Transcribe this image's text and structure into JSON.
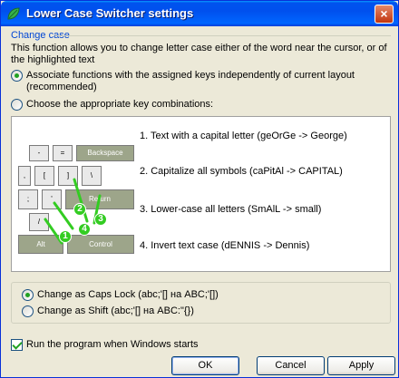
{
  "window": {
    "title": "Lower Case Switcher settings",
    "close_glyph": "×"
  },
  "group": {
    "label": "Change case"
  },
  "description": "This function allows you to change letter case either of the word near the cursor, or of the highlighted text",
  "radios_mode": [
    {
      "label": "Associate functions with the assigned keys independently of current layout (recommended)",
      "checked": true
    },
    {
      "label": "Choose the appropriate key combinations:",
      "checked": false
    }
  ],
  "keyboard": {
    "keys": [
      {
        "label": "-"
      },
      {
        "label": "="
      },
      {
        "label": "Backspace"
      },
      {
        "label": ","
      },
      {
        "label": "["
      },
      {
        "label": "]"
      },
      {
        "label": "\\"
      },
      {
        "label": ";"
      },
      {
        "label": "'"
      },
      {
        "label": "Return"
      },
      {
        "label": "/"
      },
      {
        "label": "Alt"
      },
      {
        "label": "Control"
      }
    ],
    "markers": [
      "1",
      "2",
      "3",
      "4"
    ]
  },
  "functions": [
    "1. Text with a capital letter (geOrGe -> George)",
    "2. Capitalize all symbols (caPitAl -> CAPITAL)",
    "3. Lower-case all letters  (SmAlL -> small)",
    "4. Invert text case (dENNIS -> Dennis)"
  ],
  "radios_case": [
    {
      "label": "Change as Caps Lock (abc;'[] на ABC;'[])",
      "checked": true
    },
    {
      "label": "Change as Shift (abc;'[] на ABC:\"{})",
      "checked": false
    }
  ],
  "startup": {
    "label": "Run the program when Windows starts",
    "checked": true
  },
  "buttons": {
    "ok": "OK",
    "cancel": "Cancel",
    "apply": "Apply"
  },
  "colors": {
    "titlebar": "#0055e5",
    "group_label": "#0046d5",
    "marker": "#33cc22",
    "key_dark": "#9da58a"
  }
}
